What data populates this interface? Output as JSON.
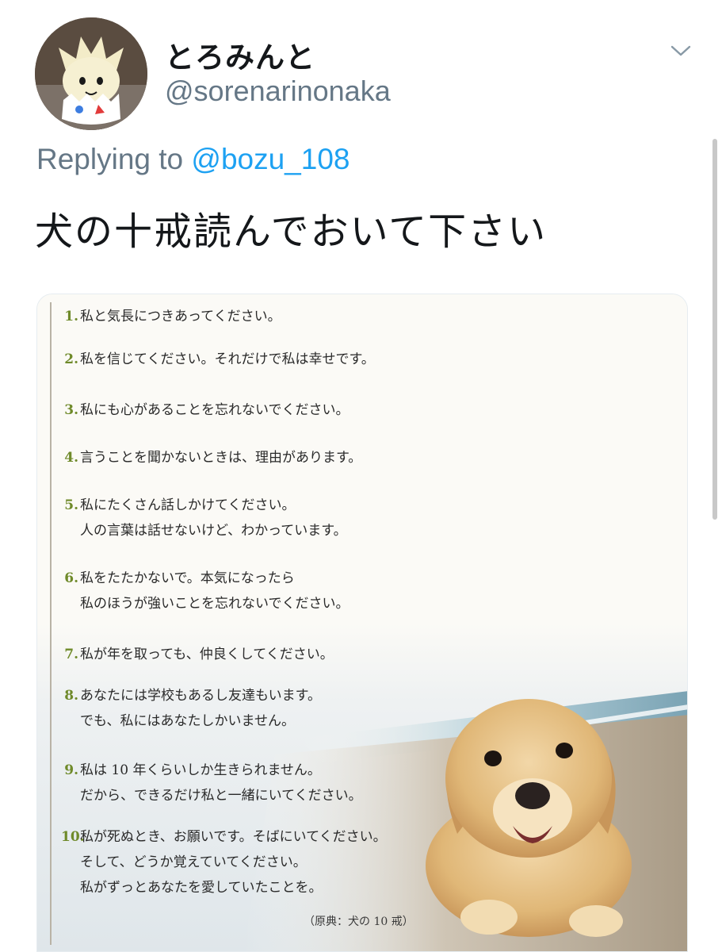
{
  "user": {
    "display_name": "とろみんと",
    "handle": "@sorenarinonaka"
  },
  "reply": {
    "prefix": "Replying to",
    "mention": "@bozu_108"
  },
  "tweet": {
    "text": "犬の十戒読んでおいて下さい"
  },
  "media": {
    "commandments": [
      {
        "num": "1.",
        "lines": [
          "私と気長につきあってください。"
        ]
      },
      {
        "num": "2.",
        "lines": [
          "私を信じてください。それだけで私は幸せです。"
        ]
      },
      {
        "num": "3.",
        "lines": [
          "私にも心があることを忘れないでください。"
        ]
      },
      {
        "num": "4.",
        "lines": [
          "言うことを聞かないときは、理由があります。"
        ]
      },
      {
        "num": "5.",
        "lines": [
          "私にたくさん話しかけてください。",
          "人の言葉は話せないけど、わかっています。"
        ]
      },
      {
        "num": "6.",
        "lines": [
          "私をたたかないで。本気になったら",
          "私のほうが強いことを忘れないでください。"
        ]
      },
      {
        "num": "7.",
        "lines": [
          "私が年を取っても、仲良くしてください。"
        ]
      },
      {
        "num": "8.",
        "lines": [
          "あなたには学校もあるし友達もいます。",
          "でも、私にはあなたしかいません。"
        ]
      },
      {
        "num": "9.",
        "lines": [
          "私は 10 年くらいしか生きられません。",
          "だから、できるだけ私と一緒にいてください。"
        ]
      },
      {
        "num": "10.",
        "lines": [
          "私が死ぬとき、お願いです。そばにいてください。",
          "そして、どうか覚えていてください。",
          "私がずっとあなたを愛していたことを。"
        ]
      }
    ],
    "source": "（原典：犬の 10 戒）"
  },
  "colors": {
    "link": "#1da1f2",
    "secondary_text": "#657786",
    "primary_text": "#14171a",
    "number_accent": "#6f8a2a"
  },
  "icons": {
    "menu": "chevron-down-icon"
  }
}
